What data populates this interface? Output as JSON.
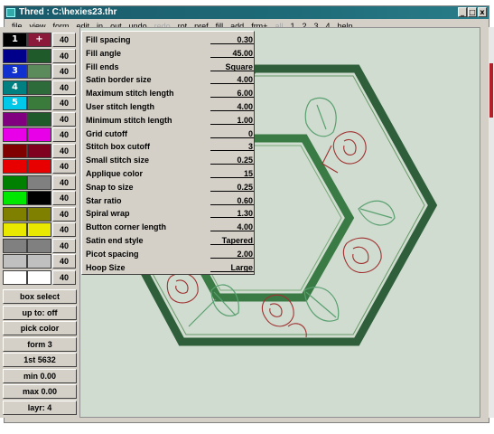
{
  "titlebar": {
    "title": "Thred : C:\\hexies23.thr",
    "buttons": [
      "_",
      "□",
      "x"
    ]
  },
  "menubar": {
    "items": [
      {
        "label": "file",
        "disabled": false
      },
      {
        "label": "view",
        "disabled": false
      },
      {
        "label": "form",
        "disabled": false
      },
      {
        "label": "edit",
        "disabled": false
      },
      {
        "label": "in",
        "disabled": false
      },
      {
        "label": "out",
        "disabled": false
      },
      {
        "label": "undo",
        "disabled": false
      },
      {
        "label": "redo",
        "disabled": true
      },
      {
        "label": "rot",
        "disabled": false
      },
      {
        "label": "pref",
        "disabled": false
      },
      {
        "label": "fill",
        "disabled": false
      },
      {
        "label": "add",
        "disabled": false
      },
      {
        "label": "frm+",
        "disabled": false
      },
      {
        "label": "all",
        "disabled": true
      },
      {
        "label": "1",
        "disabled": false
      },
      {
        "label": "2",
        "disabled": false
      },
      {
        "label": "3",
        "disabled": false
      },
      {
        "label": "4",
        "disabled": false
      },
      {
        "label": "help",
        "disabled": false
      }
    ]
  },
  "palette": {
    "colors": [
      {
        "left": "#000000",
        "right": "#8b1a3a",
        "label": "1",
        "value": "40"
      },
      {
        "left": "#00008b",
        "right": "#1f5a2a",
        "label": "",
        "value": "40"
      },
      {
        "left": "#1030d0",
        "right": "#5b8b5b",
        "label": "3",
        "value": "40"
      },
      {
        "left": "#008080",
        "right": "#2d6b3a",
        "label": "4",
        "value": "40"
      },
      {
        "left": "#00c8e8",
        "right": "#3a7a3a",
        "label": "5",
        "value": "40"
      },
      {
        "left": "#800080",
        "right": "#1f5a2a",
        "label": "",
        "value": "40"
      },
      {
        "left": "#e800e8",
        "right": "#e800e8",
        "label": "",
        "value": "40"
      },
      {
        "left": "#800000",
        "right": "#800020",
        "label": "",
        "value": "40"
      },
      {
        "left": "#e80000",
        "right": "#e80000",
        "label": "",
        "value": "40"
      },
      {
        "left": "#008000",
        "right": "#808080",
        "label": "",
        "value": "40"
      },
      {
        "left": "#00e800",
        "right": "#000000",
        "label": "",
        "value": "40"
      },
      {
        "left": "#808000",
        "right": "#808000",
        "label": "",
        "value": "40"
      },
      {
        "left": "#e8e800",
        "right": "#e8e800",
        "label": "",
        "value": "40"
      },
      {
        "left": "#808080",
        "right": "#808080",
        "label": "",
        "value": "40"
      },
      {
        "left": "#c0c0c0",
        "right": "#c0c0c0",
        "label": "",
        "value": "40"
      },
      {
        "left": "#ffffff",
        "right": "#ffffff",
        "label": "",
        "value": "40"
      }
    ],
    "selected_marker": "+"
  },
  "status_buttons": [
    "box select",
    "up to: off",
    "pick color",
    "form 3",
    "1st 5632",
    "min 0.00",
    "max 0.00",
    "layr: 4"
  ],
  "preferences": [
    {
      "label": "Fill spacing",
      "value": "0.30"
    },
    {
      "label": "Fill angle",
      "value": "45.00"
    },
    {
      "label": "Fill ends",
      "value": "Square"
    },
    {
      "label": "Satin border size",
      "value": "4.00"
    },
    {
      "label": "Maximum stitch length",
      "value": "6.00"
    },
    {
      "label": "User stitch length",
      "value": "4.00"
    },
    {
      "label": "Minimum stitch length",
      "value": "1.00"
    },
    {
      "label": "Grid cutoff",
      "value": "0"
    },
    {
      "label": "Stitch box cutoff",
      "value": "3"
    },
    {
      "label": "Small stitch size",
      "value": "0.25"
    },
    {
      "label": "Applique color",
      "value": "15"
    },
    {
      "label": "Snap to size",
      "value": "0.25"
    },
    {
      "label": "Star ratio",
      "value": "0.60"
    },
    {
      "label": "Spiral wrap",
      "value": "1.30"
    },
    {
      "label": "Button corner length",
      "value": "4.00"
    },
    {
      "label": "Satin end style",
      "value": "Tapered"
    },
    {
      "label": "Picot spacing",
      "value": "2.00"
    },
    {
      "label": "Hoop Size",
      "value": "Large"
    }
  ],
  "colors": {
    "canvas_bg": "#cfdccf",
    "hex_outer": "#2f5f3a",
    "hex_inner": "#3a7a44",
    "leaf_green": "#5aa070",
    "rose_red": "#a03030",
    "title_bar": "#1f6b78"
  }
}
